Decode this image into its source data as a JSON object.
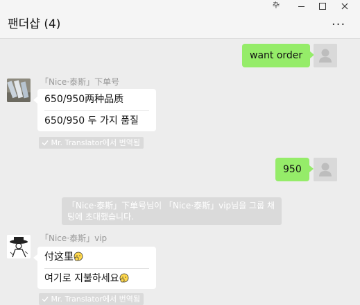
{
  "window": {
    "pin_label": "卆",
    "chat_title": "팬더샵 (4)",
    "more_label": "..."
  },
  "messages": [
    {
      "type": "me",
      "text": "want order"
    },
    {
      "type": "them",
      "sender": "「Nice·泰斯」下单号",
      "original": "650/950两种品质",
      "translated": "650/950 두 가지 품질",
      "badge": "Mr. Translator에서 번역됨"
    },
    {
      "type": "me",
      "text": "950"
    },
    {
      "type": "system",
      "text": "「Nice·泰斯」下单号님이 「Nice·泰斯」vip님을 그룹 채팅에 초대했습니다."
    },
    {
      "type": "them",
      "sender": "「Nice·泰斯」vip",
      "original": "付这里",
      "translated": "여기로 지불하세요",
      "badge": "Mr. Translator에서 번역됨"
    }
  ],
  "icons": {
    "user_avatar": "user-silhouette-icon",
    "sender1_avatar": "rolled-paper-photo",
    "sender2_avatar": "sketch-hat-figure",
    "emoji": "face-palm-emoji-icon",
    "check": "check-icon"
  },
  "colors": {
    "my_bubble": "#95ec69",
    "their_bubble": "#ffffff",
    "background": "#ededed",
    "badge": "#dadada"
  }
}
